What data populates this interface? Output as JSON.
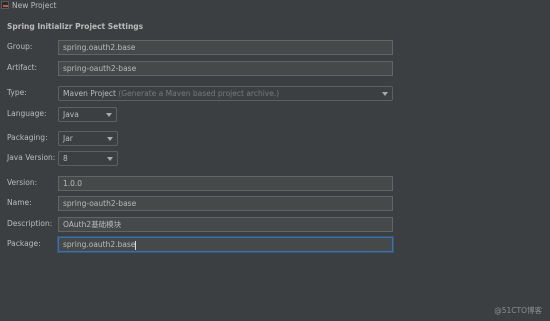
{
  "window": {
    "title": "New Project"
  },
  "section": {
    "title": "Spring Initializr Project Settings"
  },
  "form": {
    "group": {
      "label": "Group:",
      "value": "spring.oauth2.base"
    },
    "artifact": {
      "label": "Artifact:",
      "value": "spring-oauth2-base"
    },
    "type": {
      "label": "Type:",
      "value": "Maven Project",
      "hint": "(Generate a Maven based project archive.)"
    },
    "language": {
      "label": "Language:",
      "value": "Java"
    },
    "packaging": {
      "label": "Packaging:",
      "value": "Jar"
    },
    "java_version": {
      "label": "Java Version:",
      "value": "8"
    },
    "version": {
      "label": "Version:",
      "value": "1.0.0"
    },
    "name": {
      "label": "Name:",
      "value": "spring-oauth2-base"
    },
    "description": {
      "label": "Description:",
      "value": "OAuth2基础模块"
    },
    "package": {
      "label": "Package:",
      "value": "spring.oauth2.base"
    }
  },
  "watermark": "@51CTO博客",
  "colors": {
    "background": "#3c3f41",
    "field_background": "#45494a",
    "focus_border": "#3d6fa8",
    "text": "#bbbbbb"
  }
}
